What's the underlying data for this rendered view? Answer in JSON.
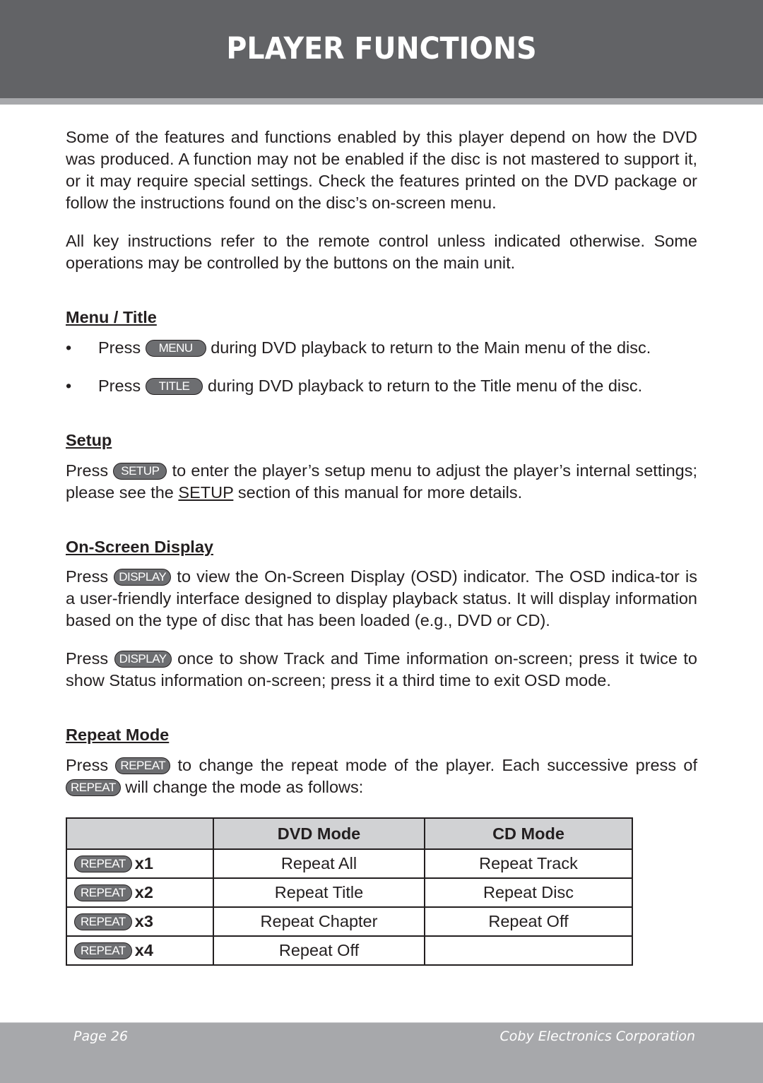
{
  "header": {
    "title": "PLAYER FUNCTIONS"
  },
  "intro": {
    "paragraph1": "Some of the features and functions enabled by this player depend on how the DVD was produced. A function may not be enabled if the disc is not mastered to support it, or it may require special settings. Check the features printed on the DVD package or follow the instructions found on the disc’s on-screen menu.",
    "paragraph2": "All key instructions refer to the remote control unless indicated otherwise. Some operations may be controlled by the buttons on the main unit."
  },
  "sections": {
    "menu_title": {
      "heading": "Menu / Title",
      "bullet_char": "•",
      "items": [
        {
          "prefix": "Press",
          "key": "MENU",
          "suffix": "during DVD playback to return to the Main menu of the disc."
        },
        {
          "prefix": "Press",
          "key": "TITLE",
          "suffix": "during DVD playback to return to the Title menu of the disc."
        }
      ]
    },
    "setup": {
      "heading": "Setup",
      "prefix": "Press",
      "key": "SETUP",
      "text_a": "to enter the player’s setup menu to adjust the player’s internal settings; please see the",
      "link": "SETUP",
      "text_b": "section of this manual for more details."
    },
    "osd": {
      "heading": "On-Screen Display",
      "p1_prefix": "Press",
      "p1_key": "DISPLAY",
      "p1_text": "to view the On-Screen Display (OSD) indicator. The OSD indica-tor is a user-friendly interface designed to display playback status. It will display information based on the type of disc that has been loaded (e.g., DVD or CD).",
      "p2_prefix": "Press",
      "p2_key": "DISPLAY",
      "p2_text": "once to show Track and Time information on-screen; press it twice to show Status information on-screen; press it a third time to exit OSD mode."
    },
    "repeat": {
      "heading": "Repeat Mode",
      "prefix": "Press",
      "key": "REPEAT",
      "text_a": "to change the repeat mode of the player. Each successive press of",
      "key2": "REPEAT",
      "text_b": "will change the mode as follows:",
      "table": {
        "headers": [
          "",
          "DVD Mode",
          "CD Mode"
        ],
        "rows": [
          {
            "key": "REPEAT",
            "times": "x1",
            "dvd": "Repeat All",
            "cd": "Repeat Track"
          },
          {
            "key": "REPEAT",
            "times": "x2",
            "dvd": "Repeat Title",
            "cd": "Repeat Disc"
          },
          {
            "key": "REPEAT",
            "times": "x3",
            "dvd": "Repeat Chapter",
            "cd": "Repeat Off"
          },
          {
            "key": "REPEAT",
            "times": "x4",
            "dvd": "Repeat Off",
            "cd": ""
          }
        ]
      }
    }
  },
  "footer": {
    "page": "Page 26",
    "company": "Coby Electronics Corporation"
  }
}
